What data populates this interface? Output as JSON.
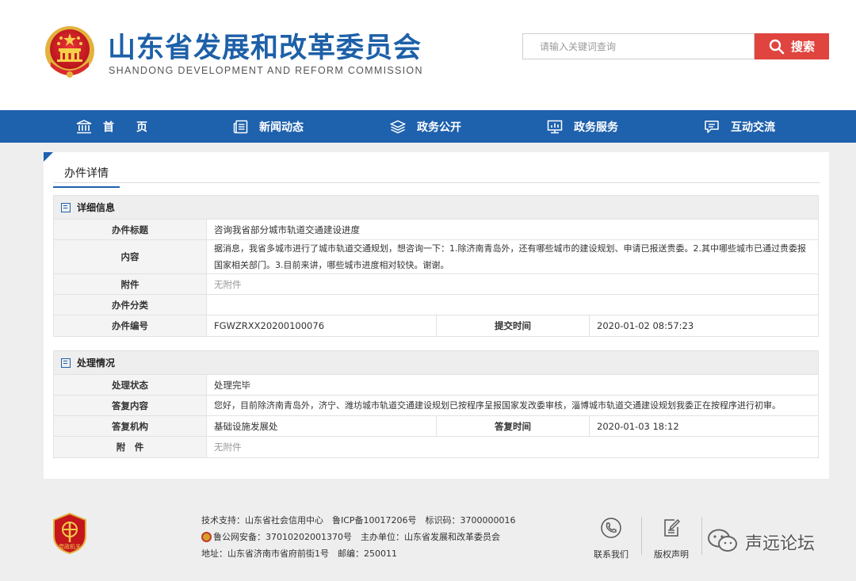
{
  "header": {
    "title_cn": "山东省发展和改革委员会",
    "title_en": "SHANDONG DEVELOPMENT AND REFORM COMMISSION",
    "search_placeholder": "请输入关键词查询",
    "search_label": "搜索"
  },
  "nav": [
    {
      "label": "首　　页",
      "icon": "bank-icon"
    },
    {
      "label": "新闻动态",
      "icon": "news-icon"
    },
    {
      "label": "政务公开",
      "icon": "layers-icon"
    },
    {
      "label": "政务服务",
      "icon": "monitor-chart-icon"
    },
    {
      "label": "互动交流",
      "icon": "chat-icon"
    }
  ],
  "panel": {
    "tab": "办件详情",
    "details": {
      "heading": "详细信息",
      "title_label": "办件标题",
      "title_value": "咨询我省部分城市轨道交通建设进度",
      "content_label": "内容",
      "content_value": "据消息，我省多城市进行了城市轨道交通规划，想咨询一下：1.除济南青岛外，还有哪些城市的建设规划、申请已报送贵委。2.其中哪些城市已通过贵委报国家相关部门。3.目前来讲，哪些城市进度相对较快。谢谢。",
      "attachment_label": "附件",
      "attachment_value": "无附件",
      "category_label": "办件分类",
      "category_value": "",
      "number_label": "办件编号",
      "number_value": "FGWZRXX20200100076",
      "submit_time_label": "提交时间",
      "submit_time_value": "2020-01-02 08:57:23"
    },
    "processing": {
      "heading": "处理情况",
      "status_label": "处理状态",
      "status_value": "处理完毕",
      "reply_label": "答复内容",
      "reply_value": "您好，目前除济南青岛外，济宁、潍坊城市轨道交通建设规划已按程序呈报国家发改委审核，淄博城市轨道交通建设规划我委正在按程序进行初审。",
      "org_label": "答复机构",
      "org_value": "基础设施发展处",
      "reply_time_label": "答复时间",
      "reply_time_value": "2020-01-03 18:12",
      "attachment_label": "附　件",
      "attachment_value": "无附件"
    }
  },
  "footer": {
    "logo_text": "党政机关",
    "line1": "技术支持：山东省社会信用中心　鲁ICP备10017206号　标识码：3700000016",
    "line2": "鲁公网安备：37010202001370号　主办单位：山东省发展和改革委员会",
    "line3": "地址：山东省济南市省府前街1号　邮编：250011",
    "links": [
      {
        "label": "联系我们",
        "icon": "phone-icon"
      },
      {
        "label": "版权声明",
        "icon": "edit-document-icon"
      }
    ],
    "watermark": "声远论坛"
  },
  "colors": {
    "primary": "#1e61ad",
    "title": "#1d60a8",
    "search_button": "#e0443e"
  }
}
